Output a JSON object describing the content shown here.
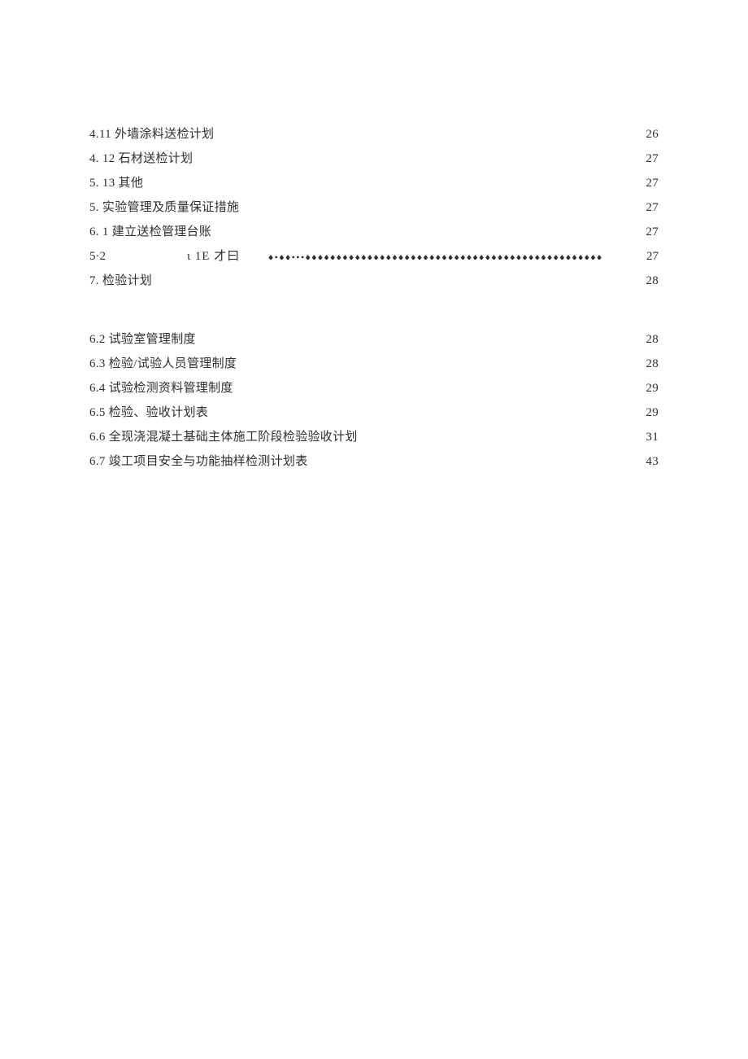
{
  "toc_block1": [
    {
      "label": "4.11 外墙涂料送检计划 ",
      "page": " 26",
      "leader": "dots"
    },
    {
      "label": "4.   12 石材送检计划 ",
      "page": " 27",
      "leader": "dots"
    },
    {
      "label": "5.   13 其他 ",
      "page": " 27",
      "leader": "dots"
    },
    {
      "label": "5. 实验管理及质量保证措施 ",
      "page": " 27",
      "leader": "dots"
    },
    {
      "label": "6.   1 建立送检管理台账 ",
      "page": " 27",
      "leader": "dots"
    }
  ],
  "odd_row": {
    "left": "5·2",
    "mid": "ι 1E 才曰",
    "page": "27",
    "leader": "diamonds"
  },
  "toc_after_odd": [
    {
      "label": "7.   检验计划",
      "page": " 28",
      "leader": "dots"
    }
  ],
  "toc_block2": [
    {
      "label": "6.2 试验室管理制度",
      "page": " 28",
      "leader": "dots"
    },
    {
      "label": "6.3 检验/试验人员管理制度",
      "page": " 28",
      "leader": "dots"
    },
    {
      "label": "6.4 试验检测资料管理制度",
      "page": " 29",
      "leader": "dots"
    },
    {
      "label": "6.5 检验、验收计划表 ",
      "page": " 29",
      "leader": "dots"
    },
    {
      "label": "6.6 全现浇混凝土基础主体施工阶段检验验收计划",
      "page": " 31",
      "leader": "dots"
    },
    {
      "label": "6.7 竣工项目安全与功能抽样检测计划表",
      "page": " 43",
      "leader": "dots"
    }
  ]
}
